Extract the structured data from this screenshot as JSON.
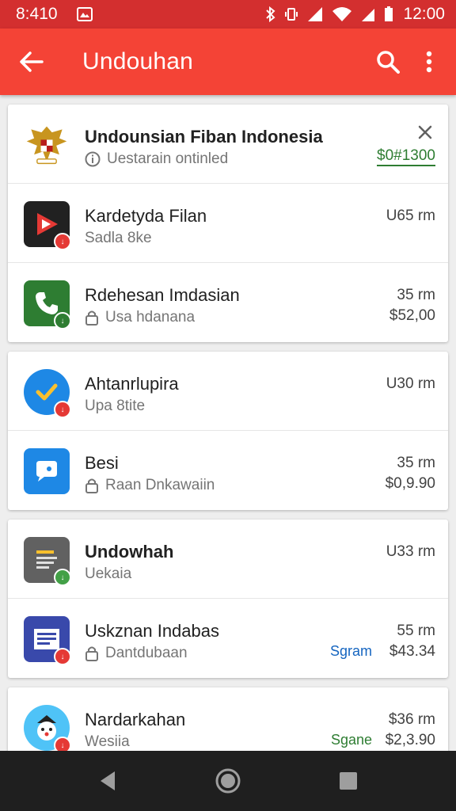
{
  "status_bar": {
    "time": "8:410",
    "clock": "12:00"
  },
  "app_bar": {
    "title": "Undouhan"
  },
  "colors": {
    "primary": "#f44336",
    "status": "#d32f2f",
    "green": "#2e7d32",
    "blue": "#1565c0"
  },
  "cards": [
    {
      "rows": [
        {
          "name": "Undounsian Fiban Indonesia",
          "sub": "Uestarain ontinled",
          "price": "$0#1300",
          "icon": "garuda-emblem-icon",
          "sub_icon": "info-icon",
          "close": true
        },
        {
          "name": "Kardetyda Filan",
          "sub": "Sadla 8ke",
          "size": "U65 rm",
          "icon": "play-app-icon"
        },
        {
          "name": "Rdehesan Imdasian",
          "sub": "Usa hdanana",
          "size": "35 rm",
          "price": "$52,00",
          "icon": "phone-app-icon",
          "sub_icon": "lock-icon"
        }
      ]
    },
    {
      "rows": [
        {
          "name": "Ahtanrlupira",
          "sub": "Upa 8tite",
          "size": "U30 rm",
          "icon": "check-app-icon"
        },
        {
          "name": "Besi",
          "sub": "Raan Dnkawaiin",
          "size": "35 rm",
          "price": "$0,9.90",
          "icon": "chat-app-icon",
          "sub_icon": "lock-icon"
        }
      ]
    },
    {
      "rows": [
        {
          "name": "Undowhah",
          "sub": "Uekaia",
          "size": "U33 rm",
          "icon": "notes-app-icon"
        },
        {
          "name": "Uskznan Indabas",
          "sub": "Dantdubaan",
          "size": "55 rm",
          "price": "$43.34",
          "tag": "Sgram",
          "icon": "document-app-icon",
          "sub_icon": "lock-icon"
        }
      ]
    },
    {
      "rows": [
        {
          "name": "Nardarkahan",
          "sub": "Wesiia",
          "size": "$36 rm",
          "price": "$2,3.90",
          "tag": "Sgane",
          "icon": "character-app-icon"
        }
      ]
    }
  ]
}
